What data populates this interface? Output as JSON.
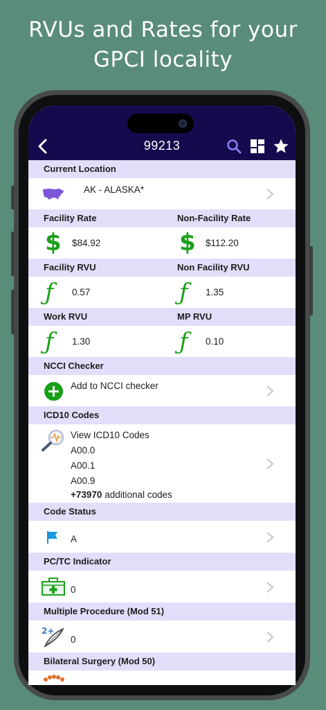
{
  "promo": {
    "line1": "RVUs and Rates for your",
    "line2": "GPCI locality"
  },
  "nav": {
    "title": "99213",
    "icons": [
      "back-chevron-icon",
      "search-icon",
      "layout-grid-icon",
      "star-icon"
    ]
  },
  "current_location": {
    "header": "Current Location",
    "value": "AK - ALASKA*",
    "icon": "usa-map-icon"
  },
  "rates": {
    "facility_header": "Facility Rate",
    "nonfacility_header": "Non-Facility Rate",
    "symbol": "$",
    "facility_value": "$84.92",
    "nonfacility_value": "$112.20"
  },
  "rvu": {
    "facility_header": "Facility RVU",
    "nonfacility_header": "Non Facility RVU",
    "symbol": "ƒ",
    "facility_value": "0.57",
    "nonfacility_value": "1.35"
  },
  "work_mp": {
    "work_header": "Work RVU",
    "mp_header": "MP RVU",
    "work_value": "1.30",
    "mp_value": "0.10"
  },
  "ncci": {
    "header": "NCCI Checker",
    "label": "Add to NCCI checker"
  },
  "icd10": {
    "header": "ICD10 Codes",
    "view_label": "View ICD10 Codes",
    "codes": [
      "A00.0",
      "A00.1",
      "A00.9"
    ],
    "additional_count": "+73970",
    "additional_label": "additional codes"
  },
  "code_status": {
    "header": "Code Status",
    "value": "A"
  },
  "pctc": {
    "header": "PC/TC Indicator",
    "value": "0"
  },
  "multiple_procedure": {
    "header": "Multiple Procedure (Mod 51)",
    "value": "0",
    "icon_text": "2+"
  },
  "bilateral": {
    "header": "Bilateral Surgery (Mod 50)"
  },
  "colors": {
    "background": "#5a8c7a",
    "nav": "#140b4e",
    "section_header": "#e2def9",
    "accent_green": "#1aa01a",
    "nav_icon_purple": "#8a7cf0"
  }
}
